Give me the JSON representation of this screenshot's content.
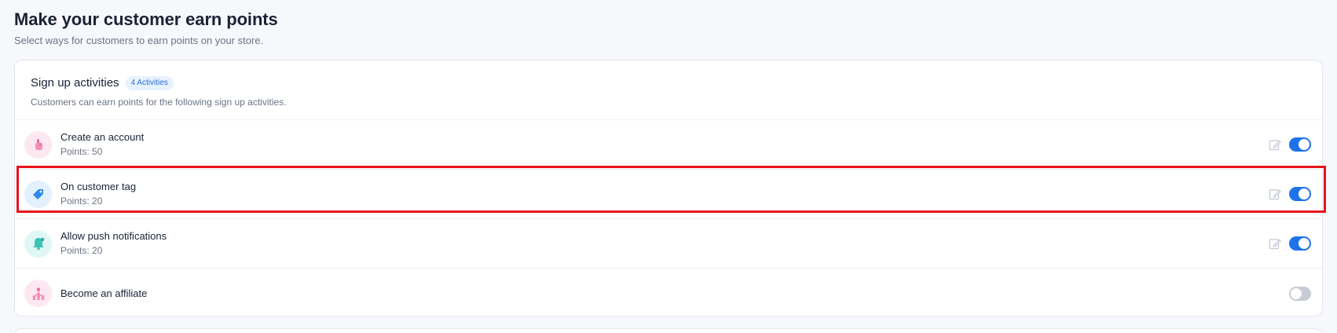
{
  "page": {
    "title": "Make your customer earn points",
    "subtitle": "Select ways for customers to earn points on your store."
  },
  "card": {
    "title": "Sign up activities",
    "badge": "4 Activities",
    "description": "Customers can earn points for the following sign up activities."
  },
  "activities": [
    {
      "title": "Create an account",
      "points": "Points: 50",
      "icon": "pointing-hand-icon",
      "enabled": true
    },
    {
      "title": "On customer tag",
      "points": "Points: 20",
      "icon": "tag-icon",
      "enabled": true
    },
    {
      "title": "Allow push notifications",
      "points": "Points: 20",
      "icon": "bell-icon",
      "enabled": true
    },
    {
      "title": "Become an affiliate",
      "points": "",
      "icon": "network-people-icon",
      "enabled": false
    }
  ],
  "colors": {
    "accent": "#1e73e8",
    "highlight": "#e8141a",
    "badge_bg": "#e6f2fd",
    "toggle_off": "#c7ccd6"
  }
}
